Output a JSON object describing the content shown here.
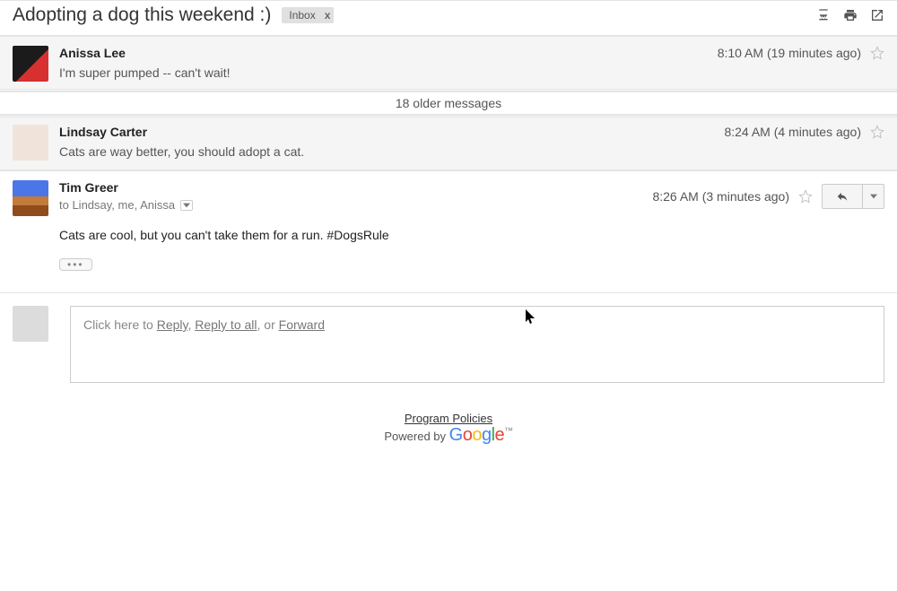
{
  "header": {
    "subject": "Adopting a dog this weekend :)",
    "label": "Inbox",
    "label_close": "x"
  },
  "messages": {
    "collapsed1": {
      "sender": "Anissa Lee",
      "snippet": "I'm super pumped -- can't wait!",
      "time": "8:10 AM (19 minutes ago)"
    },
    "older": "18 older messages",
    "collapsed2": {
      "sender": "Lindsay Carter",
      "snippet": "Cats are way better, you should adopt a cat.",
      "time": "8:24 AM (4 minutes ago)"
    },
    "expanded": {
      "sender": "Tim Greer",
      "recipients": "to Lindsay, me, Anissa",
      "time": "8:26 AM (3 minutes ago)",
      "body": "Cats are cool, but you can't take them for a run. #DogsRule",
      "trimmed": "•••"
    }
  },
  "reply": {
    "prefix": "Click here to ",
    "reply": "Reply",
    "sep1": ", ",
    "reply_all": "Reply to all",
    "sep2": ", or ",
    "forward": "Forward"
  },
  "footer": {
    "policies": "Program Policies",
    "powered": "Powered by "
  }
}
